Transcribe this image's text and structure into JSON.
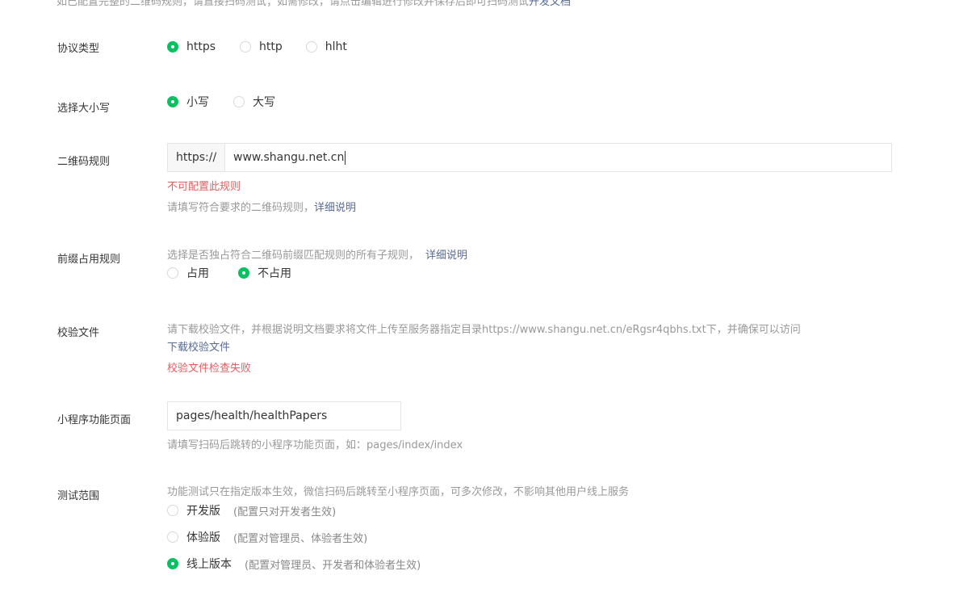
{
  "top_hint": {
    "text": "如已配置完整的二维码规则，请直接扫码测试；如需修改，请点击编辑进行修改并保存后即可扫码测试",
    "link": "开发文档"
  },
  "protocol": {
    "label": "协议类型",
    "options": [
      {
        "label": "https",
        "checked": true
      },
      {
        "label": "http",
        "checked": false
      },
      {
        "label": "hlht",
        "checked": false
      }
    ]
  },
  "case": {
    "label": "选择大小写",
    "options": [
      {
        "label": "小写",
        "checked": true
      },
      {
        "label": "大写",
        "checked": false
      }
    ]
  },
  "qr_rule": {
    "label": "二维码规则",
    "prefix": "https://",
    "value": "www.shangu.net.cn",
    "error": "不可配置此规则",
    "hint": "请填写符合要求的二维码规则，",
    "hint_link": "详细说明"
  },
  "prefix_rule": {
    "label": "前缀占用规则",
    "hint": "选择是否独占符合二维码前缀匹配规则的所有子规则，",
    "hint_link": "详细说明",
    "options": [
      {
        "label": "占用",
        "checked": false
      },
      {
        "label": "不占用",
        "checked": true
      }
    ]
  },
  "verify_file": {
    "label": "校验文件",
    "hint": "请下载校验文件，并根据说明文档要求将文件上传至服务器指定目录https://www.shangu.net.cn/eRgsr4qbhs.txt下，并确保可以访问",
    "download_link": "下载校验文件",
    "error": "校验文件检查失败"
  },
  "page_path": {
    "label": "小程序功能页面",
    "value": "pages/health/healthPapers",
    "hint": "请填写扫码后跳转的小程序功能页面，如：pages/index/index"
  },
  "test_scope": {
    "label": "测试范围",
    "hint": "功能测试只在指定版本生效，微信扫码后跳转至小程序页面，可多次修改，不影响其他用户线上服务",
    "options": [
      {
        "label": "开发版",
        "note": "(配置只对开发者生效)",
        "checked": false
      },
      {
        "label": "体验版",
        "note": "(配置对管理员、体验者生效)",
        "checked": false
      },
      {
        "label": "线上版本",
        "note": "(配置对管理员、开发者和体验者生效)",
        "checked": true
      }
    ]
  },
  "colors": {
    "accent": "#07c160",
    "link": "#576b95",
    "error": "#e15f63",
    "hint": "#999999"
  }
}
